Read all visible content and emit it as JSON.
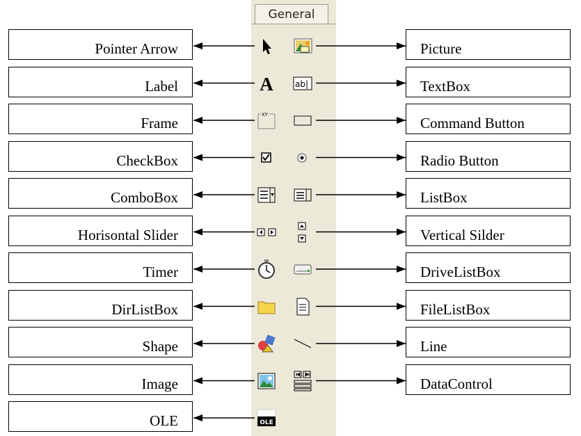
{
  "toolbox": {
    "tab_label": "General"
  },
  "left_labels": [
    {
      "text": "Pointer Arrow",
      "icon": "pointer-arrow-icon"
    },
    {
      "text": "Label",
      "icon": "label-icon"
    },
    {
      "text": "Frame",
      "icon": "frame-icon"
    },
    {
      "text": "CheckBox",
      "icon": "checkbox-icon"
    },
    {
      "text": "ComboBox",
      "icon": "combobox-icon"
    },
    {
      "text": "Horisontal Slider",
      "icon": "horizontal-scrollbar-icon"
    },
    {
      "text": "Timer",
      "icon": "timer-icon"
    },
    {
      "text": "DirListBox",
      "icon": "folder-icon"
    },
    {
      "text": "Shape",
      "icon": "shape-icon"
    },
    {
      "text": "Image",
      "icon": "image-icon"
    },
    {
      "text": "OLE",
      "icon": "ole-icon"
    }
  ],
  "right_labels": [
    {
      "text": "Picture",
      "icon": "picture-icon"
    },
    {
      "text": "TextBox",
      "icon": "textbox-icon"
    },
    {
      "text": "Command Button",
      "icon": "command-button-icon"
    },
    {
      "text": "Radio Button",
      "icon": "radio-button-icon"
    },
    {
      "text": "ListBox",
      "icon": "listbox-icon"
    },
    {
      "text": "Vertical Silder",
      "icon": "vertical-scrollbar-icon"
    },
    {
      "text": "DriveListBox",
      "icon": "drive-icon"
    },
    {
      "text": "FileListBox",
      "icon": "file-icon"
    },
    {
      "text": "Line",
      "icon": "line-icon"
    },
    {
      "text": "DataControl",
      "icon": "data-control-icon"
    }
  ],
  "colors": {
    "toolbox_bg": "#ece9d8",
    "line": "#000000"
  }
}
